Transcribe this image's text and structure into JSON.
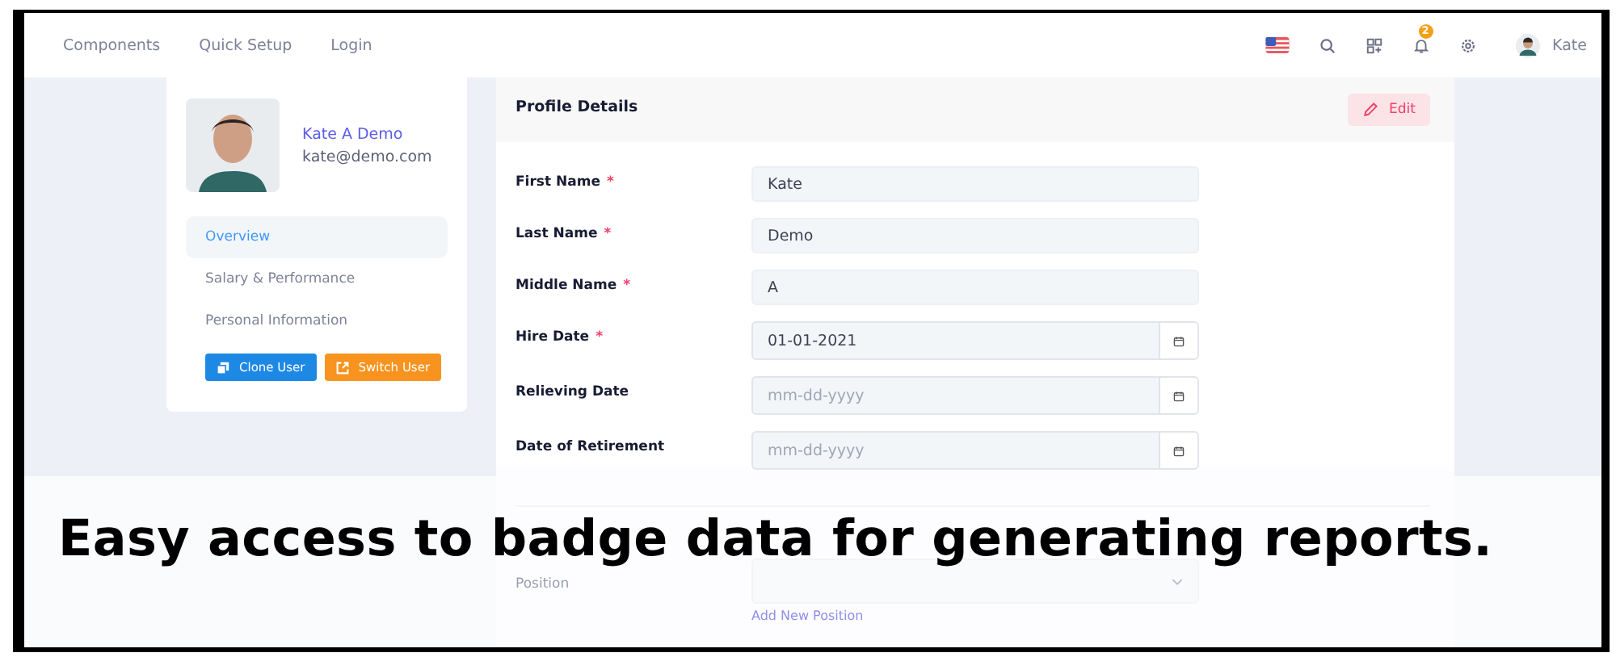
{
  "nav": {
    "links": [
      "Components",
      "Quick Setup",
      "Login"
    ],
    "notification_count": "2",
    "user_name": "Kate"
  },
  "profile": {
    "name": "Kate A Demo",
    "email": "kate@demo.com",
    "menu": [
      {
        "label": "Overview",
        "selected": true
      },
      {
        "label": "Salary & Performance",
        "selected": false
      },
      {
        "label": "Personal Information",
        "selected": false
      }
    ],
    "buttons": [
      {
        "label": "Clone User",
        "kind": "clone"
      },
      {
        "label": "Switch User",
        "kind": "switch"
      }
    ]
  },
  "details": {
    "title": "Profile Details",
    "edit_button": "Edit",
    "required_mark": "*",
    "fields": [
      {
        "label": "First Name",
        "required": true,
        "kind": "text",
        "value": "Kate"
      },
      {
        "label": "Last Name",
        "required": true,
        "kind": "text",
        "value": "Demo"
      },
      {
        "label": "Middle Name",
        "required": true,
        "kind": "text",
        "value": "A"
      },
      {
        "label": "Hire Date",
        "required": true,
        "kind": "date",
        "value": "01-01-2021"
      },
      {
        "label": "Relieving Date",
        "required": false,
        "kind": "date",
        "placeholder": "mm-dd-yyyy"
      },
      {
        "label": "Date of Retirement",
        "required": false,
        "kind": "date",
        "placeholder": "mm-dd-yyyy"
      }
    ],
    "faded_fields": [
      {
        "label": "Position",
        "kind": "select",
        "link": "Add New Position"
      }
    ]
  },
  "caption": "Easy access to badge data for generating reports."
}
